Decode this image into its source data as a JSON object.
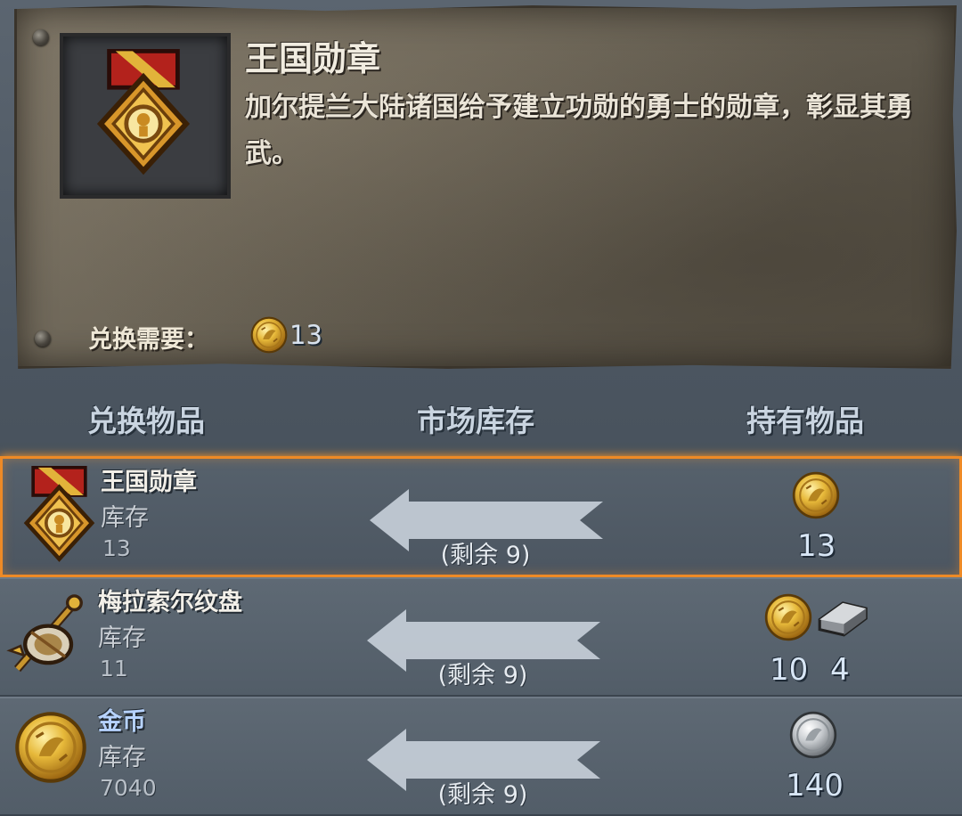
{
  "detail": {
    "title": "王国勋章",
    "description": "加尔提兰大陆诸国给予建立功勋的勇士的勋章，彰显其勇武。",
    "requirement_label": "兑换需要：",
    "requirement_currency_icon": "gold-coin-icon",
    "requirement_value": "13",
    "item_icon": "royal-medal-icon"
  },
  "columns": {
    "exchange_item": "兑换物品",
    "market_stock": "市场库存",
    "owned_items": "持有物品"
  },
  "rows": [
    {
      "name": "王国勋章",
      "icon": "royal-medal-icon",
      "stock_label": "库存",
      "stock_value": "13",
      "remaining": "(剩余 9)",
      "selected": true,
      "owned": [
        {
          "icon": "gold-coin-icon",
          "value": "13"
        }
      ]
    },
    {
      "name": "梅拉索尔纹盘",
      "icon": "mirasol-disc-icon",
      "stock_label": "库存",
      "stock_value": "11",
      "remaining": "(剩余 9)",
      "selected": false,
      "owned": [
        {
          "icon": "gold-coin-icon",
          "value": "10"
        },
        {
          "icon": "iron-ingot-icon",
          "value": "4"
        }
      ]
    },
    {
      "name": "金币",
      "icon": "gold-coin-icon",
      "stock_label": "库存",
      "stock_value": "7040",
      "remaining": "(剩余 9)",
      "selected": false,
      "owned": [
        {
          "icon": "silver-coin-icon",
          "value": "140"
        }
      ]
    }
  ],
  "colors": {
    "selection_border": "#ee8a26",
    "name_highlight": "#b7d3ff",
    "panel": "#6b6456"
  }
}
